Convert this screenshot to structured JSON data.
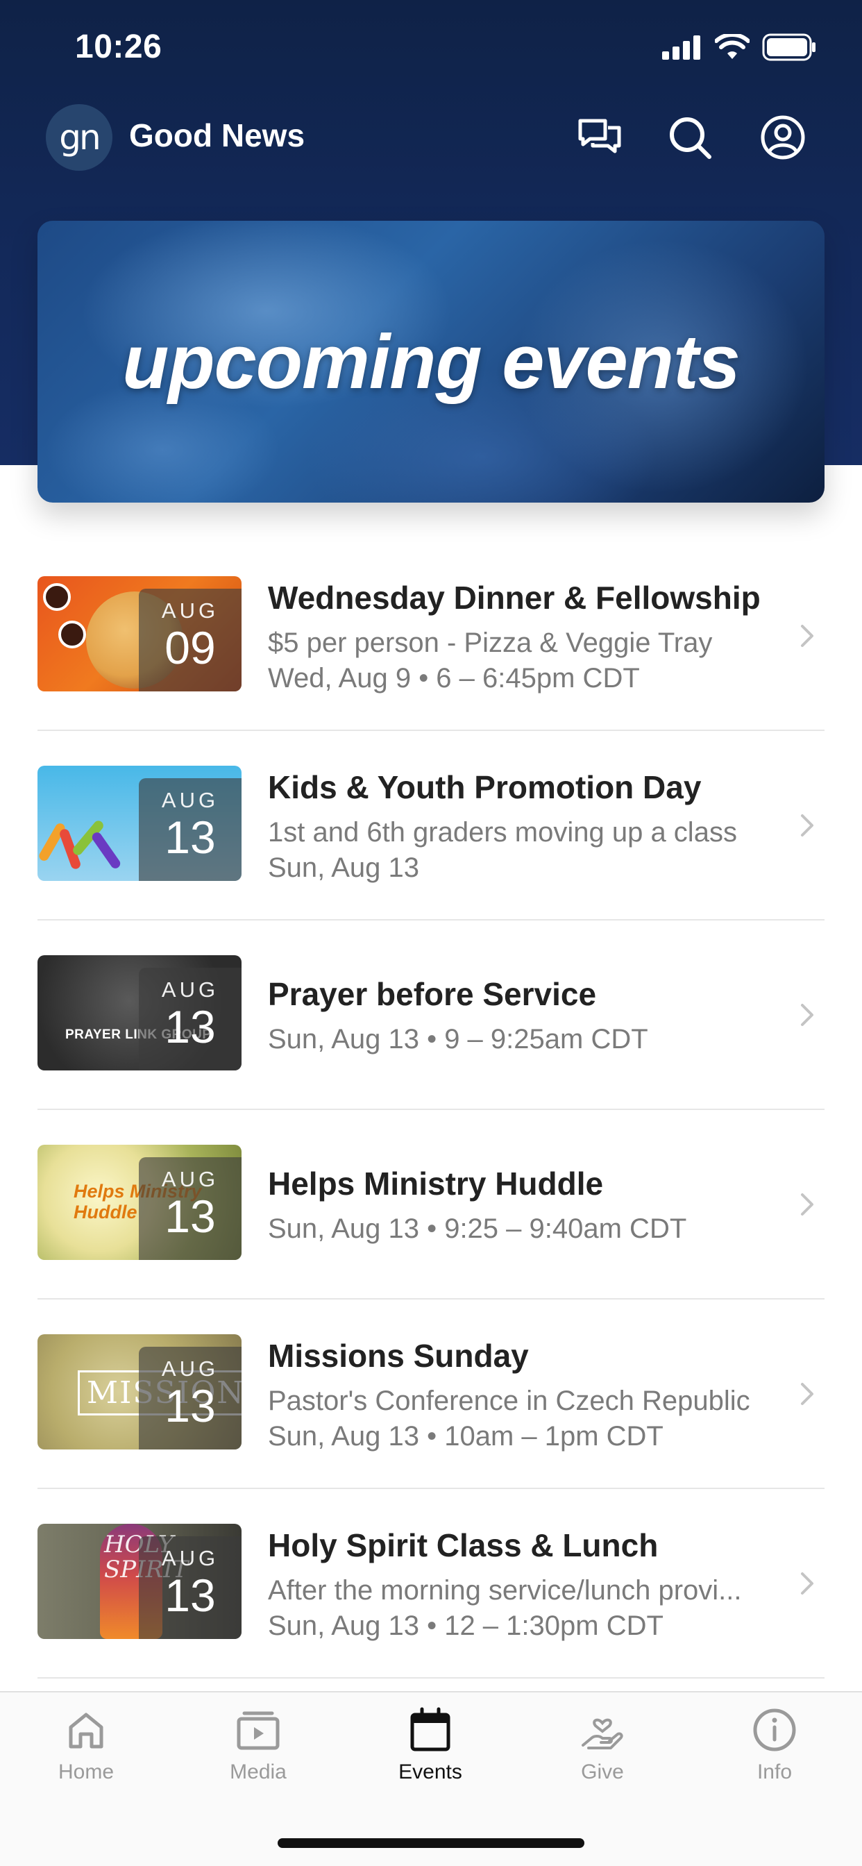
{
  "status_bar": {
    "time": "10:26"
  },
  "app_bar": {
    "logo_text": "gn",
    "title": "Good News"
  },
  "banner": {
    "text": "upcoming events"
  },
  "events": [
    {
      "month": "AUG",
      "day": "09",
      "title": "Wednesday Dinner & Fellowship",
      "line1": "$5 per person - Pizza & Veggie Tray",
      "line2": "Wed, Aug 9 • 6 – 6:45pm CDT"
    },
    {
      "month": "AUG",
      "day": "13",
      "title": "Kids & Youth Promotion Day",
      "line1": "1st and 6th graders moving up a class",
      "line2": "Sun, Aug 13"
    },
    {
      "month": "AUG",
      "day": "13",
      "title": "Prayer before Service",
      "line1": "Sun, Aug 13 • 9 – 9:25am CDT",
      "thumb_text": "PRAYER LINK GROUP"
    },
    {
      "month": "AUG",
      "day": "13",
      "title": "Helps Ministry Huddle",
      "line1": "Sun, Aug 13 • 9:25 – 9:40am CDT",
      "thumb_text": "Helps Ministry Huddle"
    },
    {
      "month": "AUG",
      "day": "13",
      "title": "Missions Sunday",
      "line1": "Pastor's Conference in Czech Republic",
      "line2": "Sun, Aug 13 • 10am – 1pm CDT",
      "thumb_text": "MISSIONS"
    },
    {
      "month": "AUG",
      "day": "13",
      "title": "Holy Spirit Class & Lunch",
      "line1": "After the morning service/lunch provi...",
      "line2": "Sun, Aug 13 • 12 – 1:30pm CDT",
      "thumb_text": "HOLY SPIRIT"
    }
  ],
  "tabs": [
    {
      "label": "Home",
      "icon": "home-icon"
    },
    {
      "label": "Media",
      "icon": "media-icon"
    },
    {
      "label": "Events",
      "icon": "calendar-icon",
      "active": true
    },
    {
      "label": "Give",
      "icon": "give-icon"
    },
    {
      "label": "Info",
      "icon": "info-icon"
    }
  ],
  "colors": {
    "header_bg": "#13295a",
    "text_primary": "#222222",
    "text_secondary": "#7a7a7a",
    "tab_inactive": "#9a9a9a"
  }
}
